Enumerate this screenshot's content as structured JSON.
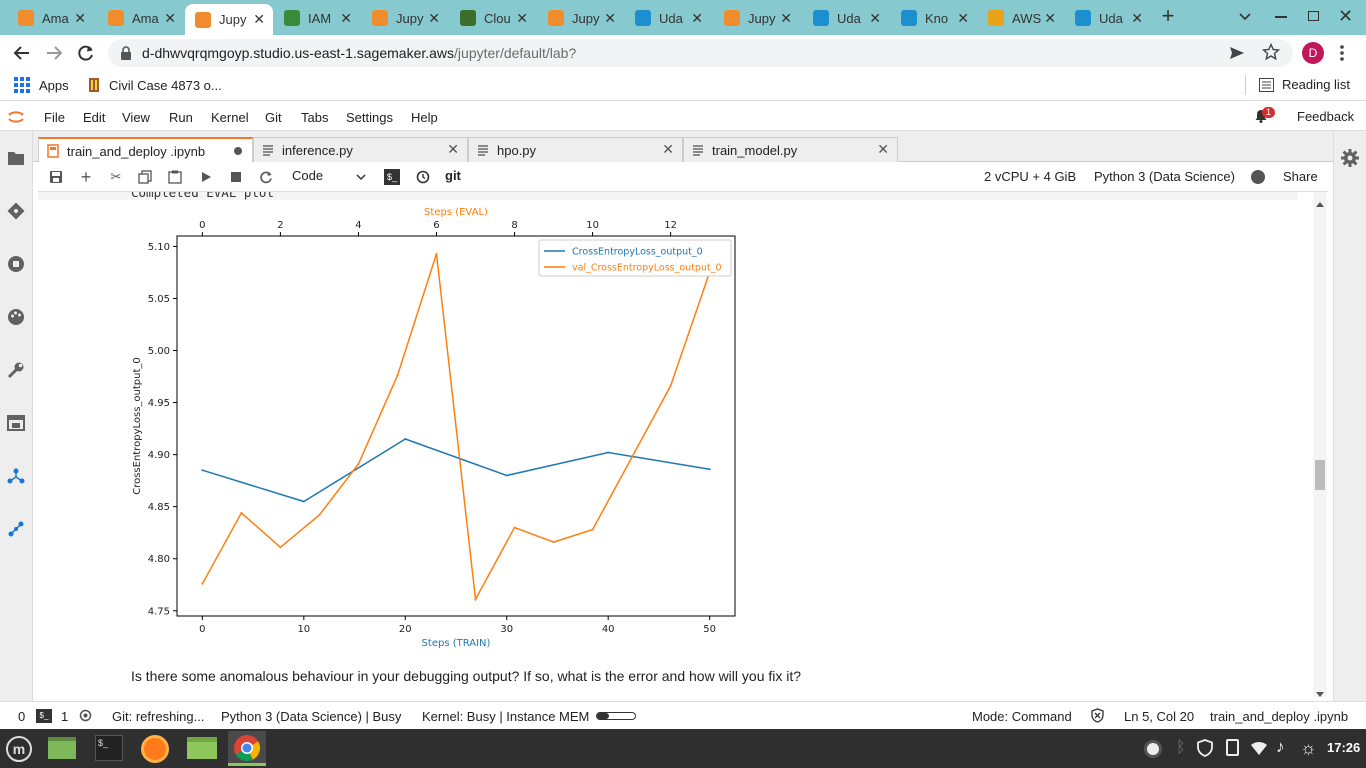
{
  "browser": {
    "tabs": [
      {
        "title": "Ama",
        "icon": "aws-box-icon",
        "color": "#f08c2c"
      },
      {
        "title": "Ama",
        "icon": "aws-box-icon",
        "color": "#f08c2c"
      },
      {
        "title": "Jupy",
        "icon": "jupyter-hourglass-icon",
        "color": "#f08c2c",
        "active": true
      },
      {
        "title": "IAM",
        "icon": "iam-key-icon",
        "color": "#3a8a3a"
      },
      {
        "title": "Jupy",
        "icon": "jupyter-icon",
        "color": "#f08c2c"
      },
      {
        "title": "Clou",
        "icon": "cloudwatch-icon",
        "color": "#3a6e2a"
      },
      {
        "title": "Jupy",
        "icon": "jupyter-icon",
        "color": "#f08c2c"
      },
      {
        "title": "Uda",
        "icon": "udacity-icon",
        "color": "#1c8fce"
      },
      {
        "title": "Jupy",
        "icon": "jupyter-icon",
        "color": "#f08c2c"
      },
      {
        "title": "Uda",
        "icon": "udacity-icon",
        "color": "#1c8fce"
      },
      {
        "title": "Kno",
        "icon": "udacity-icon",
        "color": "#1c8fce"
      },
      {
        "title": "AWS",
        "icon": "aws-gift-icon",
        "color": "#e8a317"
      },
      {
        "title": "Uda",
        "icon": "udacity-icon",
        "color": "#1c8fce"
      }
    ],
    "url_host": "d-dhwvqrqmgoyp.studio.us-east-1.sagemaker.aws",
    "url_path": "/jupyter/default/lab?",
    "profile_initial": "D",
    "bookmarks": [
      {
        "label": "Apps"
      },
      {
        "label": "Civil Case 4873 o..."
      }
    ],
    "reading_list": "Reading list"
  },
  "jupyter": {
    "menus": [
      "File",
      "Edit",
      "View",
      "Run",
      "Kernel",
      "Git",
      "Tabs",
      "Settings",
      "Help"
    ],
    "notification_count": "1",
    "feedback": "Feedback",
    "doc_tabs": [
      {
        "label": "train_and_deploy .ipynb",
        "active": true
      },
      {
        "label": "inference.py"
      },
      {
        "label": "hpo.py"
      },
      {
        "label": "train_model.py"
      }
    ],
    "cell_type": "Code",
    "git_label": "git",
    "instance": "2 vCPU + 4 GiB",
    "kernel": "Python 3 (Data Science)",
    "share": "Share",
    "output_text": "Completed EVAL plot",
    "markdown": "Is there some anomalous behaviour in your debugging output? If so, what is the error and how will you fix it?"
  },
  "status": {
    "left_count_a": "0",
    "left_count_b": "1",
    "git": "Git: refreshing...",
    "kernel": "Python 3 (Data Science) | Busy",
    "kernel_busy": "Kernel: Busy | Instance MEM",
    "mode": "Mode: Command",
    "position": "Ln 5, Col 20",
    "file": "train_and_deploy .ipynb"
  },
  "taskbar": {
    "time": "17:26"
  },
  "chart_data": {
    "type": "line",
    "top_xlabel": "Steps (EVAL)",
    "xlabel": "Steps (TRAIN)",
    "ylabel": "CrossEntropyLoss_output_0",
    "xlim": [
      -2.5,
      52.5
    ],
    "top_xlim": [
      -0.65,
      13.65
    ],
    "ylim": [
      4.745,
      5.11
    ],
    "x_ticks": [
      0,
      10,
      20,
      30,
      40,
      50
    ],
    "top_x_ticks": [
      0,
      2,
      4,
      6,
      8,
      10,
      12
    ],
    "y_ticks": [
      "4.75",
      "4.80",
      "4.85",
      "4.90",
      "4.95",
      "5.00",
      "5.05",
      "5.10"
    ],
    "legend_position": "top-right",
    "series": [
      {
        "name": "CrossEntropyLoss_output_0",
        "axis": "bottom",
        "color": "#1f77b4",
        "x": [
          0,
          10,
          20,
          30,
          40,
          50
        ],
        "y": [
          4.885,
          4.855,
          4.915,
          4.88,
          4.902,
          4.886
        ]
      },
      {
        "name": "val_CrossEntropyLoss_output_0",
        "axis": "top",
        "color": "#ff7f0e",
        "x": [
          0,
          1,
          2,
          3,
          4,
          5,
          6,
          7,
          8,
          9,
          10,
          11,
          12,
          13
        ],
        "y": [
          4.776,
          4.844,
          4.811,
          4.842,
          4.891,
          4.976,
          5.093,
          4.761,
          4.83,
          4.816,
          4.828,
          4.897,
          4.966,
          5.075
        ]
      }
    ]
  }
}
